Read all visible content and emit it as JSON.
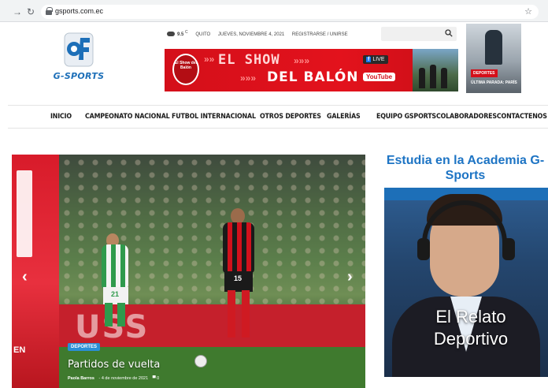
{
  "browser": {
    "url": "gsports.com.ec"
  },
  "logo": {
    "text": "G-SPORTS"
  },
  "topbar": {
    "temperature": "9.5",
    "temperature_unit": "C",
    "city": "QUITO",
    "date": "JUEVES, NOVIEMBRE 4, 2021",
    "auth": "REGISTRARSE / UNIRSE"
  },
  "banner": {
    "badge": "El Show del Balón",
    "line1": "EL SHOW",
    "line2": "DEL BALÓN",
    "live": "LIVE",
    "youtube": "YouTube"
  },
  "side_ad": {
    "tag": "DEPORTES",
    "caption": "ÚLTIMA PARADA: PARÍS"
  },
  "nav": {
    "items": [
      "INICIO",
      "CAMPEONATO NACIONAL",
      "FUTBOL INTERNACIONAL",
      "OTROS DEPORTES",
      "GALERÍAS",
      "EQUIPO GSPORTSCOLABORADORESCONTACTENOS"
    ]
  },
  "slider": {
    "prev_fragment": "EN",
    "board_text": "USS",
    "category": "DEPORTES",
    "title": "Partidos de vuelta",
    "author": "Paola Barros",
    "date": "4 de noviembre de 2021",
    "comments": "0",
    "shirt_numbers": [
      "21",
      "15"
    ]
  },
  "widget": {
    "title": "Estudia en la Academia G-Sports",
    "image_caption": "El Relato Deportivo"
  },
  "colors": {
    "brand_blue": "#1d74c4",
    "accent_red": "#d40f1a"
  }
}
